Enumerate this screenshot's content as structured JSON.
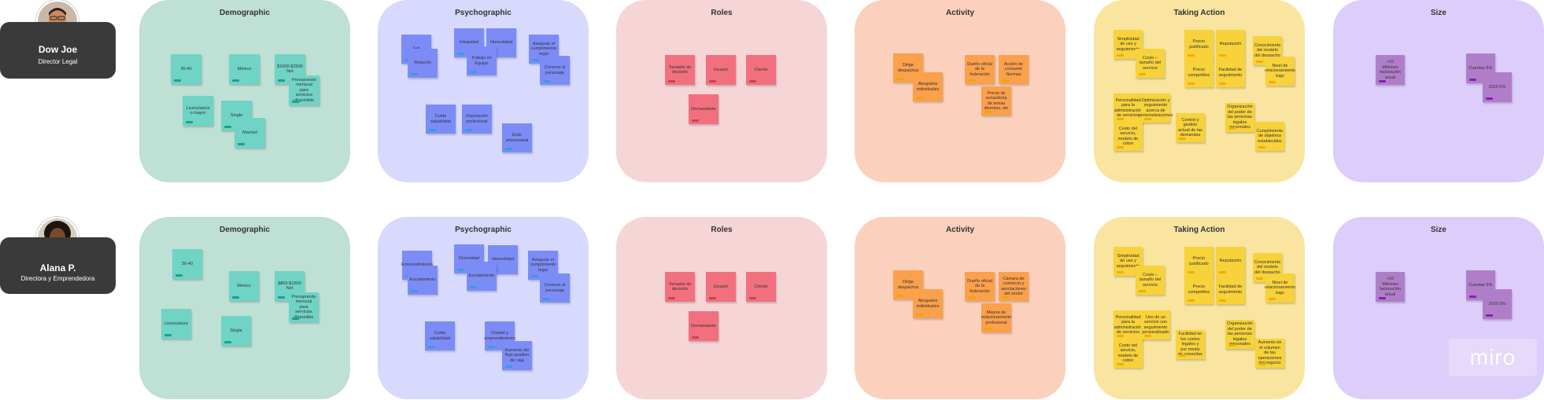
{
  "personas": [
    {
      "name": "Dow Joe",
      "role": "Director Legal"
    },
    {
      "name": "Alana P.",
      "role": "Directora y Emprendedora"
    }
  ],
  "titles": {
    "demographic": "Demographic",
    "psychographic": "Psychographic",
    "roles": "Roles",
    "activity": "Activity",
    "taking_action": "Taking Action",
    "size": "Size"
  },
  "logo": "miro",
  "row1": {
    "demographic": [
      "30-40",
      "México",
      "$1000-$2500 Net",
      "Licenciatura o mayor",
      "Single",
      "Presupuesto mensual para servicios disponible",
      "Married"
    ],
    "psychographic": [
      "Gol",
      "Integridad",
      "Honestidad",
      "Asegurar el cumplimiento legal",
      "Relación",
      "Trabajo en Equipo",
      "Conocer al personaje",
      "Cuida salubilidad",
      "Reputación profesional",
      "Éxito empresarial"
    ],
    "roles": [
      "Tomador de decisión",
      "Usuario",
      "Cliente",
      "Demandante"
    ],
    "activity": [
      "Dirige despachos",
      "Abogados individuales",
      "Dueño oficial de la federación",
      "Acción de consumir Normas",
      "Precio de consultoría de temas diversos, etc"
    ],
    "taking_action": [
      "Simplicidad de uso y seguimiento",
      "Precio justificado",
      "Reputación",
      "Conocimiento del modelo del despacho",
      "Costo – tamaño del servicio",
      "Precio competitivo",
      "Facilidad de seguimiento",
      "Nivel de relacionamiento bajo",
      "Personalidad para la administración de servicios",
      "Optimización y seguimiento acerca de personalizaciones",
      "Control y gestión actual de las demandas",
      "Organización del poder de las personas legales personales",
      "Costo del servicio, modelo de cobro",
      "Cumplimiento de objetivos establecidos"
    ],
    "size": [
      "+10 Millones facturación anual",
      "Cuentas 5%",
      "2020 5%"
    ]
  },
  "row2": {
    "demographic": [
      "30-40",
      "México",
      "$800-$1500 Net",
      "Licenciatura",
      "Presupuesto mensual para servicios disponible",
      "Single"
    ],
    "psychographic": [
      "Emprendimiento",
      "Honestidad",
      "Asegurar el cumplimiento legal",
      "Diversidad",
      "Escalamiento",
      "Conocer al personaje",
      "Cuida salubilidad",
      "Ciudad y emprendimiento",
      "Aumento del flujo positivo de caja"
    ],
    "roles": [
      "Tomador de decisión",
      "Usuario",
      "Cliente",
      "Demandante"
    ],
    "activity": [
      "Dirige despachos",
      "Abogados individuales",
      "Dueño oficial de la federación",
      "Cámara de comercio y asociaciones del sector",
      "Mejora de relacionamiento profesional"
    ],
    "taking_action": [
      "Simplicidad de uso y seguimiento",
      "Precio justificado",
      "Reputación",
      "Conocimiento del modelo del despacho",
      "Costo – tamaño del servicio",
      "Precio competitivo",
      "Facilidad de seguimiento",
      "Nivel de relacionamiento bajo",
      "Personalidad para la administración de servicios",
      "Uso de un servicio con seguimiento personalizado",
      "Facilidad en los costos legales y por medio de consultas",
      "Organización del poder de las personas legales personales",
      "Costo del servicio, modelo de cobro",
      "Aumento en el volumen de las operaciones del negocio"
    ],
    "size": [
      "+10 Millones facturación anual",
      "Cuentas 5%",
      "2020 5%"
    ]
  }
}
